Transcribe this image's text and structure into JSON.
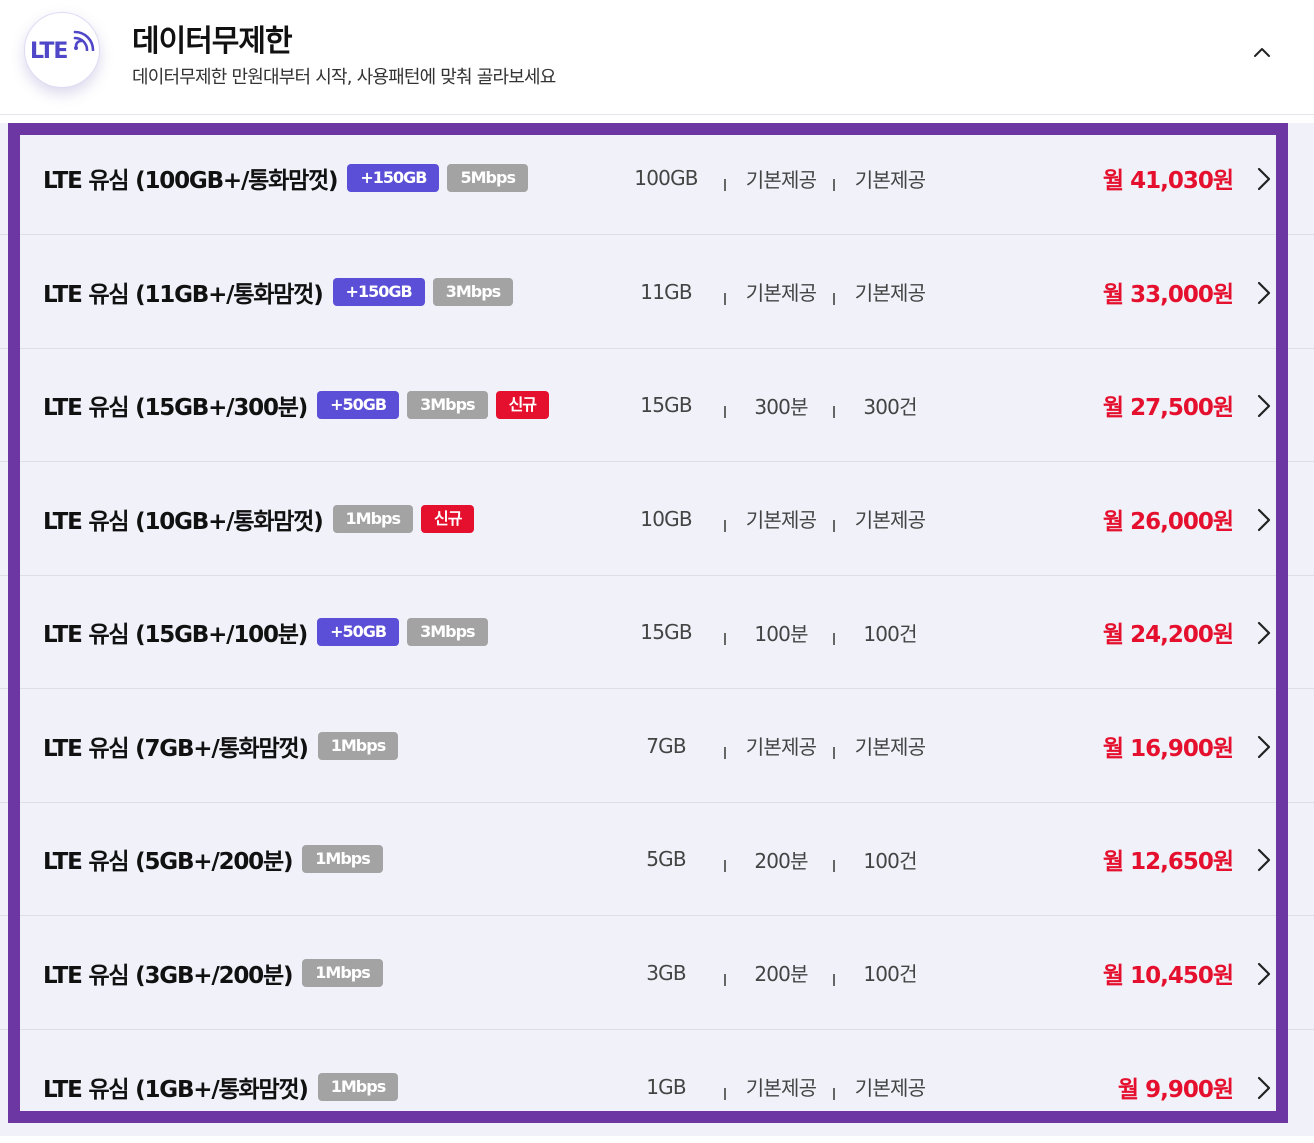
{
  "header": {
    "logo_text": "LTE",
    "title": "데이터무제한",
    "subtitle": "데이터무제한 만원대부터 시작, 사용패턴에 맞춰 골라보세요"
  },
  "plans": [
    {
      "name": "LTE 유심 (100GB+/통화맘껏)",
      "bonus": "+150GB",
      "speed": "5Mbps",
      "new": "",
      "data": "100GB",
      "voice": "기본제공",
      "sms": "기본제공",
      "price": "월 41,030원"
    },
    {
      "name": "LTE 유심 (11GB+/통화맘껏)",
      "bonus": "+150GB",
      "speed": "3Mbps",
      "new": "",
      "data": "11GB",
      "voice": "기본제공",
      "sms": "기본제공",
      "price": "월 33,000원"
    },
    {
      "name": "LTE 유심 (15GB+/300분)",
      "bonus": "+50GB",
      "speed": "3Mbps",
      "new": "신규",
      "data": "15GB",
      "voice": "300분",
      "sms": "300건",
      "price": "월 27,500원"
    },
    {
      "name": "LTE 유심 (10GB+/통화맘껏)",
      "bonus": "",
      "speed": "1Mbps",
      "new": "신규",
      "data": "10GB",
      "voice": "기본제공",
      "sms": "기본제공",
      "price": "월 26,000원"
    },
    {
      "name": "LTE 유심 (15GB+/100분)",
      "bonus": "+50GB",
      "speed": "3Mbps",
      "new": "",
      "data": "15GB",
      "voice": "100분",
      "sms": "100건",
      "price": "월 24,200원"
    },
    {
      "name": "LTE 유심 (7GB+/통화맘껏)",
      "bonus": "",
      "speed": "1Mbps",
      "new": "",
      "data": "7GB",
      "voice": "기본제공",
      "sms": "기본제공",
      "price": "월 16,900원"
    },
    {
      "name": "LTE 유심 (5GB+/200분)",
      "bonus": "",
      "speed": "1Mbps",
      "new": "",
      "data": "5GB",
      "voice": "200분",
      "sms": "100건",
      "price": "월 12,650원"
    },
    {
      "name": "LTE 유심 (3GB+/200분)",
      "bonus": "",
      "speed": "1Mbps",
      "new": "",
      "data": "3GB",
      "voice": "200분",
      "sms": "100건",
      "price": "월 10,450원"
    },
    {
      "name": "LTE 유심 (1GB+/통화맘껏)",
      "bonus": "",
      "speed": "1Mbps",
      "new": "",
      "data": "1GB",
      "voice": "기본제공",
      "sms": "기본제공",
      "price": "월 9,900원"
    }
  ],
  "colors": {
    "accent_purple": "#6c37a3",
    "bonus_badge": "#5a4fd6",
    "speed_badge": "#a3a3a3",
    "new_badge": "#e5102d",
    "price": "#e5102d"
  },
  "icons": {
    "logo": "lte-signal-icon",
    "collapse": "chevron-up-icon",
    "row_arrow": "chevron-right-icon"
  }
}
